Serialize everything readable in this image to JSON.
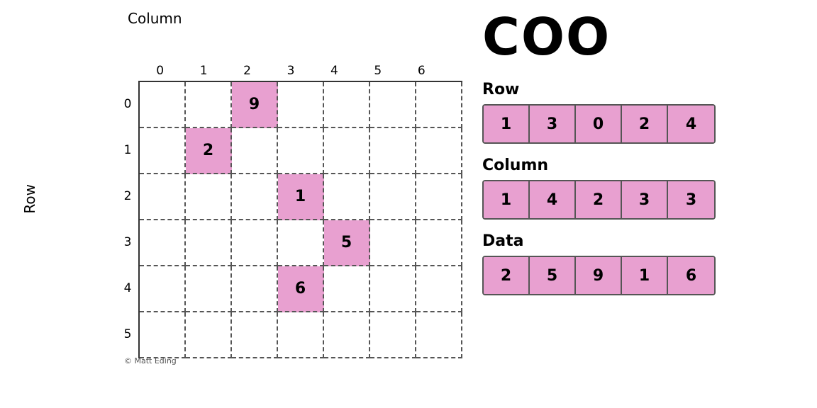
{
  "title": "COO",
  "left": {
    "column_label": "Column",
    "row_label": "Row",
    "col_headers": [
      "0",
      "1",
      "2",
      "3",
      "4",
      "5",
      "6"
    ],
    "row_headers": [
      "0",
      "1",
      "2",
      "3",
      "4",
      "5"
    ],
    "grid": {
      "rows": 6,
      "cols": 7,
      "highlighted_cells": [
        {
          "row": 0,
          "col": 2,
          "value": "9"
        },
        {
          "row": 1,
          "col": 1,
          "value": "2"
        },
        {
          "row": 2,
          "col": 3,
          "value": "1"
        },
        {
          "row": 3,
          "col": 4,
          "value": "5"
        },
        {
          "row": 4,
          "col": 3,
          "value": "6"
        }
      ]
    },
    "copyright": "© Matt Eding"
  },
  "right": {
    "row_label": "Row",
    "row_values": [
      "1",
      "3",
      "0",
      "2",
      "4"
    ],
    "column_label": "Column",
    "column_values": [
      "1",
      "4",
      "2",
      "3",
      "3"
    ],
    "data_label": "Data",
    "data_values": [
      "2",
      "5",
      "9",
      "1",
      "6"
    ]
  }
}
